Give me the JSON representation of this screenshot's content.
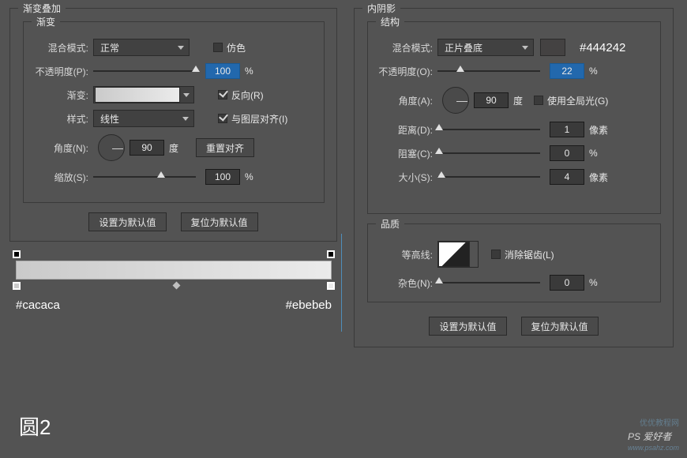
{
  "left": {
    "panel_title": "渐变叠加",
    "group_title": "渐变",
    "blend_label": "混合模式:",
    "blend_value": "正常",
    "dither_label": "仿色",
    "opacity_label": "不透明度(P):",
    "opacity_value": "100",
    "percent": "%",
    "gradient_label": "渐变:",
    "reverse_label": "反向(R)",
    "style_label": "样式:",
    "style_value": "线性",
    "align_label": "与图层对齐(I)",
    "angle_label": "角度(N):",
    "angle_value": "90",
    "degree": "度",
    "reset_align_btn": "重置对齐",
    "scale_label": "缩放(S):",
    "scale_value": "100",
    "set_default_btn": "设置为默认值",
    "reset_default_btn": "复位为默认值"
  },
  "right": {
    "panel_title": "内阴影",
    "structure_title": "结构",
    "blend_label": "混合模式:",
    "blend_value": "正片叠底",
    "swatch_color": "#444242",
    "swatch_hex": "#444242",
    "opacity_label": "不透明度(O):",
    "opacity_value": "22",
    "angle_label": "角度(A):",
    "angle_value": "90",
    "degree": "度",
    "global_light_label": "使用全局光(G)",
    "distance_label": "距离(D):",
    "distance_value": "1",
    "px": "像素",
    "choke_label": "阻塞(C):",
    "choke_value": "0",
    "size_label": "大小(S):",
    "size_value": "4",
    "quality_title": "品质",
    "contour_label": "等高线:",
    "antialias_label": "消除锯齿(L)",
    "noise_label": "杂色(N):",
    "noise_value": "0",
    "percent": "%",
    "set_default_btn": "设置为默认值",
    "reset_default_btn": "复位为默认值"
  },
  "gradient_stops": {
    "left_hex": "#cacaca",
    "right_hex": "#ebebeb"
  },
  "big_label": "圆2",
  "watermark": "PS 爱好者",
  "watermark_url": "www.psahz.com",
  "wm_small": "优优教程网"
}
